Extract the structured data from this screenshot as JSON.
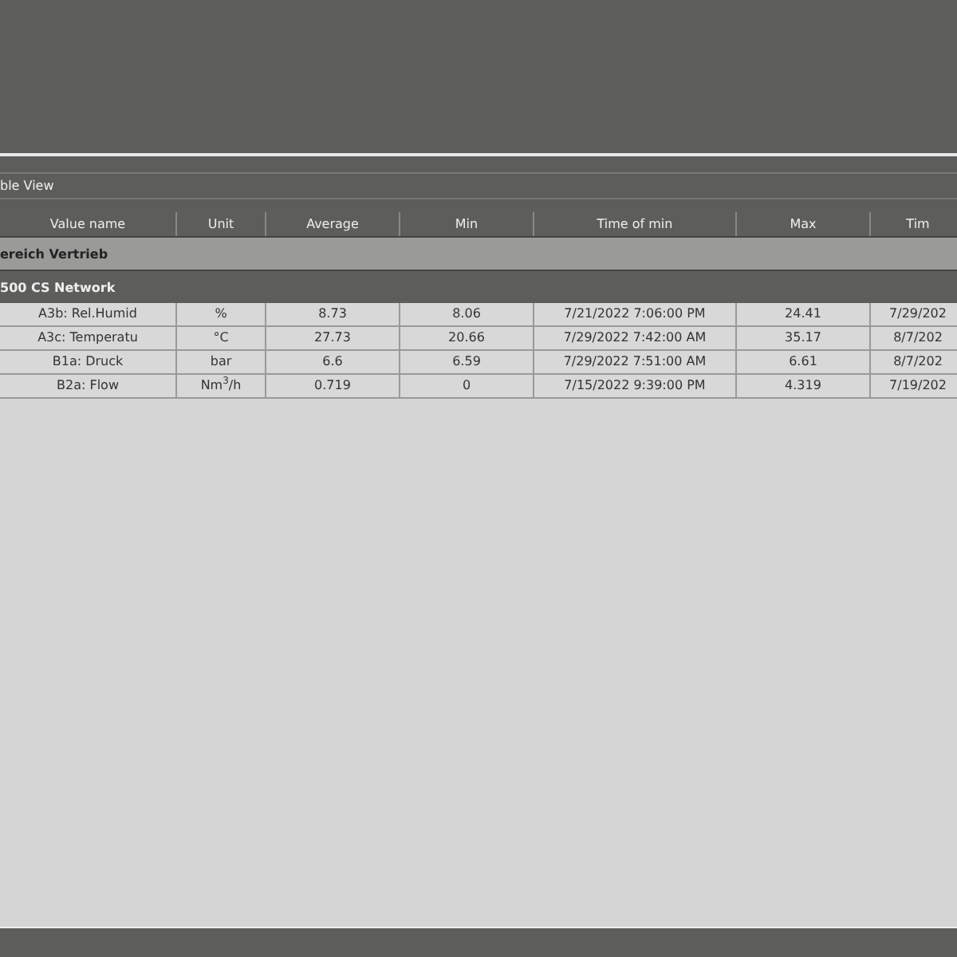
{
  "panel": {
    "title": "ble View"
  },
  "table": {
    "columns": [
      "Value name",
      "Unit",
      "Average",
      "Min",
      "Time of min",
      "Max",
      "Tim"
    ],
    "groups": [
      {
        "label": "ereich Vertrieb",
        "kind": "area"
      },
      {
        "label": "500 CS Network",
        "kind": "device"
      }
    ],
    "rows": [
      [
        "A3b: Rel.Humid",
        "%",
        "8.73",
        "8.06",
        "7/21/2022 7:06:00 PM",
        "24.41",
        "7/29/202"
      ],
      [
        "A3c: Temperatu",
        "°C",
        "27.73",
        "20.66",
        "7/29/2022 7:42:00 AM",
        "35.17",
        "8/7/202"
      ],
      [
        "B1a: Druck",
        "bar",
        "6.6",
        "6.59",
        "7/29/2022 7:51:00 AM",
        "6.61",
        "8/7/202"
      ],
      [
        "B2a: Flow",
        "Nm$^{3}$/h",
        "0.719",
        "0",
        "7/15/2022 9:39:00 PM",
        "4.319",
        "7/19/202"
      ]
    ]
  }
}
